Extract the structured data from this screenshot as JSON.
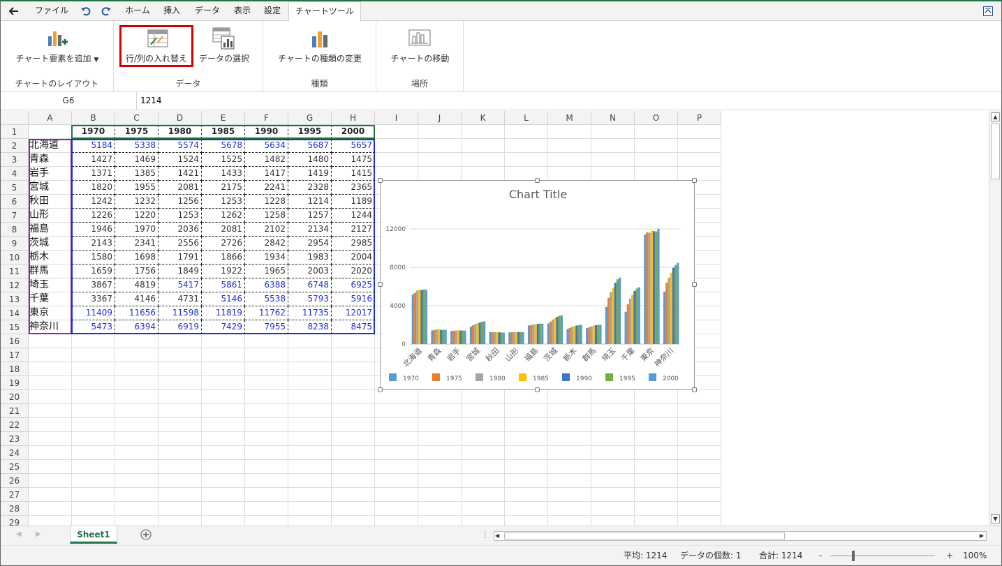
{
  "tabs": {
    "file": "ファイル",
    "home": "ホーム",
    "insert": "挿入",
    "data": "データ",
    "view": "表示",
    "settings": "設定",
    "chart_tools": "チャートツール"
  },
  "ribbon": {
    "add_element": "チャート要素を追加",
    "layout_group": "チャートのレイアウト",
    "switch_row_col": "行/列の入れ替え",
    "select_data": "データの選択",
    "data_group": "データ",
    "change_type": "チャートの種類の変更",
    "type_group": "種類",
    "move_chart": "チャートの移動",
    "location_group": "場所"
  },
  "formula_bar": {
    "name_box": "G6",
    "value": "1214"
  },
  "columns": [
    "A",
    "B",
    "C",
    "D",
    "E",
    "F",
    "G",
    "H",
    "I",
    "J",
    "K",
    "L",
    "M",
    "N",
    "O",
    "P"
  ],
  "rows": [
    "1",
    "2",
    "3",
    "4",
    "5",
    "6",
    "7",
    "8",
    "9",
    "10",
    "11",
    "12",
    "13",
    "14",
    "15",
    "16",
    "17",
    "18",
    "19",
    "20",
    "21",
    "22",
    "23",
    "24",
    "25",
    "26",
    "27",
    "28",
    "29"
  ],
  "table": {
    "years": [
      "1970",
      "1975",
      "1980",
      "1985",
      "1990",
      "1995",
      "2000"
    ],
    "prefectures": [
      "北海道",
      "青森",
      "岩手",
      "宮城",
      "秋田",
      "山形",
      "福島",
      "茨城",
      "栃木",
      "群馬",
      "埼玉",
      "千葉",
      "東京",
      "神奈川"
    ],
    "values": [
      [
        "5184",
        "5338",
        "5574",
        "5678",
        "5634",
        "5687",
        "5657"
      ],
      [
        "1427",
        "1469",
        "1524",
        "1525",
        "1482",
        "1480",
        "1475"
      ],
      [
        "1371",
        "1385",
        "1421",
        "1433",
        "1417",
        "1419",
        "1415"
      ],
      [
        "1820",
        "1955",
        "2081",
        "2175",
        "2241",
        "2328",
        "2365"
      ],
      [
        "1242",
        "1232",
        "1256",
        "1253",
        "1228",
        "1214",
        "1189"
      ],
      [
        "1226",
        "1220",
        "1253",
        "1262",
        "1258",
        "1257",
        "1244"
      ],
      [
        "1946",
        "1970",
        "2036",
        "2081",
        "2102",
        "2134",
        "2127"
      ],
      [
        "2143",
        "2341",
        "2556",
        "2726",
        "2842",
        "2954",
        "2985"
      ],
      [
        "1580",
        "1698",
        "1791",
        "1866",
        "1934",
        "1983",
        "2004"
      ],
      [
        "1659",
        "1756",
        "1849",
        "1922",
        "1965",
        "2003",
        "2020"
      ],
      [
        "3867",
        "4819",
        "5417",
        "5861",
        "6388",
        "6748",
        "6925"
      ],
      [
        "3367",
        "4146",
        "4731",
        "5146",
        "5538",
        "5793",
        "5916"
      ],
      [
        "11409",
        "11656",
        "11598",
        "11819",
        "11762",
        "11735",
        "12017"
      ],
      [
        "5473",
        "6394",
        "6919",
        "7429",
        "7955",
        "8238",
        "8475"
      ]
    ],
    "blue_cells": [
      [
        true,
        true,
        true,
        true,
        true,
        true,
        true
      ],
      [
        false,
        false,
        false,
        false,
        false,
        false,
        false
      ],
      [
        false,
        false,
        false,
        false,
        false,
        false,
        false
      ],
      [
        false,
        false,
        false,
        false,
        false,
        false,
        false
      ],
      [
        false,
        false,
        false,
        false,
        false,
        false,
        false
      ],
      [
        false,
        false,
        false,
        false,
        false,
        false,
        false
      ],
      [
        false,
        false,
        false,
        false,
        false,
        false,
        false
      ],
      [
        false,
        false,
        false,
        false,
        false,
        false,
        false
      ],
      [
        false,
        false,
        false,
        false,
        false,
        false,
        false
      ],
      [
        false,
        false,
        false,
        false,
        false,
        false,
        false
      ],
      [
        false,
        false,
        true,
        true,
        true,
        true,
        true
      ],
      [
        false,
        false,
        false,
        true,
        true,
        true,
        true
      ],
      [
        true,
        true,
        true,
        true,
        true,
        true,
        true
      ],
      [
        true,
        true,
        true,
        true,
        true,
        true,
        true
      ]
    ]
  },
  "chart_data": {
    "type": "bar",
    "title": "Chart Title",
    "categories": [
      "北海道",
      "青森",
      "岩手",
      "宮城",
      "秋田",
      "山形",
      "福島",
      "茨城",
      "栃木",
      "群馬",
      "埼玉",
      "千葉",
      "東京",
      "神奈川"
    ],
    "ylim": [
      0,
      12000
    ],
    "yticks": [
      "0",
      "4000",
      "8000",
      "12000"
    ],
    "grid": true,
    "legend_position": "bottom",
    "series": [
      {
        "name": "1970",
        "color": "#5b9bd5",
        "values": [
          5184,
          1427,
          1371,
          1820,
          1242,
          1226,
          1946,
          2143,
          1580,
          1659,
          3867,
          3367,
          11409,
          5473
        ]
      },
      {
        "name": "1975",
        "color": "#ed7d31",
        "values": [
          5338,
          1469,
          1385,
          1955,
          1232,
          1220,
          1970,
          2341,
          1698,
          1756,
          4819,
          4146,
          11656,
          6394
        ]
      },
      {
        "name": "1980",
        "color": "#a5a5a5",
        "values": [
          5574,
          1524,
          1421,
          2081,
          1256,
          1253,
          2036,
          2556,
          1791,
          1849,
          5417,
          4731,
          11598,
          6919
        ]
      },
      {
        "name": "1985",
        "color": "#ffc000",
        "values": [
          5678,
          1525,
          1433,
          2175,
          1253,
          1262,
          2081,
          2726,
          1866,
          1922,
          5861,
          5146,
          11819,
          7429
        ]
      },
      {
        "name": "1990",
        "color": "#4472c4",
        "values": [
          5634,
          1482,
          1417,
          2241,
          1228,
          1258,
          2102,
          2842,
          1934,
          1965,
          6388,
          5538,
          11762,
          7955
        ]
      },
      {
        "name": "1995",
        "color": "#70ad47",
        "values": [
          5687,
          1480,
          1419,
          2328,
          1214,
          1257,
          2134,
          2954,
          1983,
          2003,
          6748,
          5793,
          11735,
          8238
        ]
      },
      {
        "name": "2000",
        "color": "#5b9bd5",
        "values": [
          5657,
          1475,
          1415,
          2365,
          1189,
          1244,
          2127,
          2985,
          2004,
          2020,
          6925,
          5916,
          12017,
          8475
        ]
      }
    ]
  },
  "sheet_tab": "Sheet1",
  "status": {
    "average": "平均: 1214",
    "count": "データの個数: 1",
    "sum": "合計: 1214",
    "zoom_minus": "-",
    "zoom_plus": "+",
    "zoom": "100%"
  },
  "colors": {
    "accent": "#217346",
    "highlight_red": "#d40000",
    "blue_text": "#1f2fd8"
  }
}
